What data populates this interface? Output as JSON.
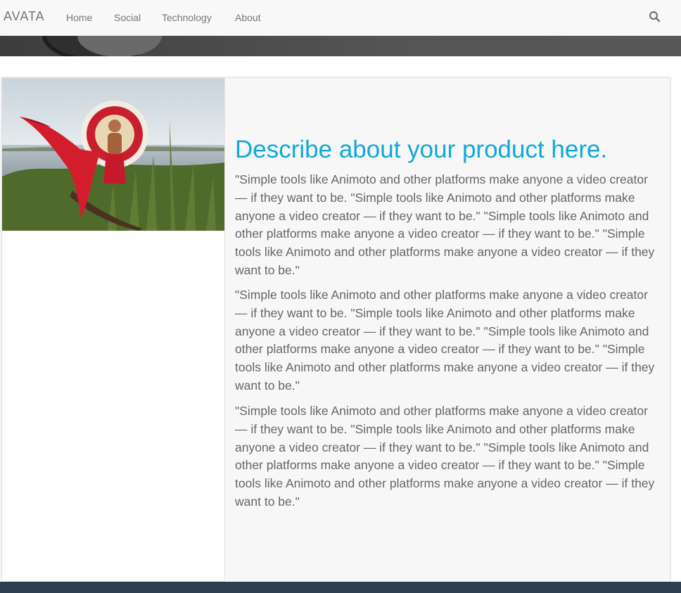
{
  "nav": {
    "brand": "AVATA",
    "links": [
      "Home",
      "Social",
      "Technology",
      "About"
    ],
    "search_icon": "search-icon"
  },
  "product": {
    "heading": "Describe about your product here.",
    "paragraphs": [
      "\"Simple tools like Animoto and other platforms make anyone a video creator — if they want to be. \"Simple tools like Animoto and other platforms make anyone a video creator — if they want to be.\" \"Simple tools like Animoto and other platforms make anyone a video creator — if they want to be.\" \"Simple tools like Animoto and other platforms make anyone a video creator — if they want to be.\"",
      "\"Simple tools like Animoto and other platforms make anyone a video creator — if they want to be. \"Simple tools like Animoto and other platforms make anyone a video creator — if they want to be.\" \"Simple tools like Animoto and other platforms make anyone a video creator — if they want to be.\" \"Simple tools like Animoto and other platforms make anyone a video creator — if they want to be.\"",
      "\"Simple tools like Animoto and other platforms make anyone a video creator — if they want to be. \"Simple tools like Animoto and other platforms make anyone a video creator — if they want to be.\" \"Simple tools like Animoto and other platforms make anyone a video creator — if they want to be.\" \"Simple tools like Animoto and other platforms make anyone a video creator — if they want to be.\""
    ]
  },
  "colors": {
    "accent": "#12a8d6",
    "navbar_bg": "#f8f8f8",
    "footer_bg": "#2c3e50",
    "text": "#666666"
  }
}
